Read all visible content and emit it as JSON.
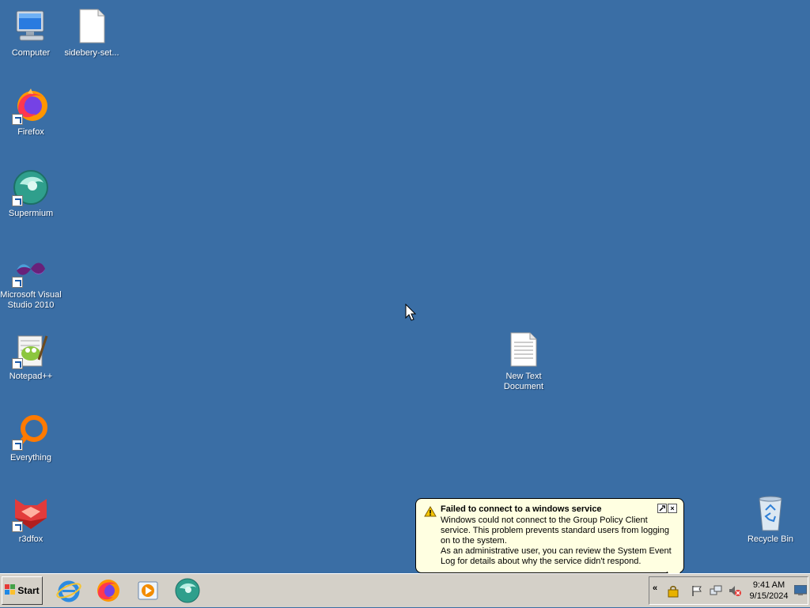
{
  "desktop": {
    "icons": [
      {
        "label": "Computer"
      },
      {
        "label": "sidebery-set..."
      },
      {
        "label": "Firefox"
      },
      {
        "label": "Supermium"
      },
      {
        "label": "Microsoft Visual Studio 2010"
      },
      {
        "label": "Notepad++"
      },
      {
        "label": "Everything"
      },
      {
        "label": "r3dfox"
      },
      {
        "label": "New Text Document"
      },
      {
        "label": "Recycle Bin"
      }
    ]
  },
  "balloon": {
    "title": "Failed to connect to a windows service",
    "body": "Windows could not connect to the Group Policy Client service. This problem prevents standard users from logging on to the system.\nAs an administrative user, you can review the System Event Log for details about why the service didn't respond.",
    "close_glyph": "×"
  },
  "taskbar": {
    "start_label": "Start",
    "quick_launch": [
      "internet-explorer-icon",
      "firefox-icon",
      "media-player-icon",
      "supermium-icon"
    ],
    "tray": {
      "expand_glyph": "«",
      "time": "9:41 AM",
      "date": "9/15/2024"
    }
  },
  "colors": {
    "desktop_bg": "#3a6ea5",
    "taskbar_bg": "#d4d0c8",
    "balloon_bg": "#ffffe1"
  }
}
